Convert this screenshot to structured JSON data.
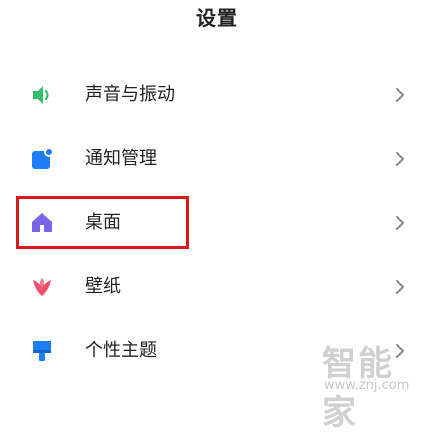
{
  "header": {
    "title": "设置"
  },
  "settings": {
    "items": [
      {
        "label": "声音与振动",
        "icon": "speaker-icon",
        "color": "#34c06a"
      },
      {
        "label": "通知管理",
        "icon": "notification-icon",
        "color": "#1e7df2"
      },
      {
        "label": "桌面",
        "icon": "home-icon",
        "color": "#7c64e8"
      },
      {
        "label": "壁纸",
        "icon": "flower-icon",
        "color": "#ee4f6c"
      },
      {
        "label": "个性主题",
        "icon": "paint-brush-icon",
        "color": "#1e7df2"
      }
    ]
  },
  "highlight": {
    "target": "桌面",
    "color": "#d9181e"
  },
  "watermark": {
    "text": "智能家",
    "url": "www.znj.com"
  }
}
